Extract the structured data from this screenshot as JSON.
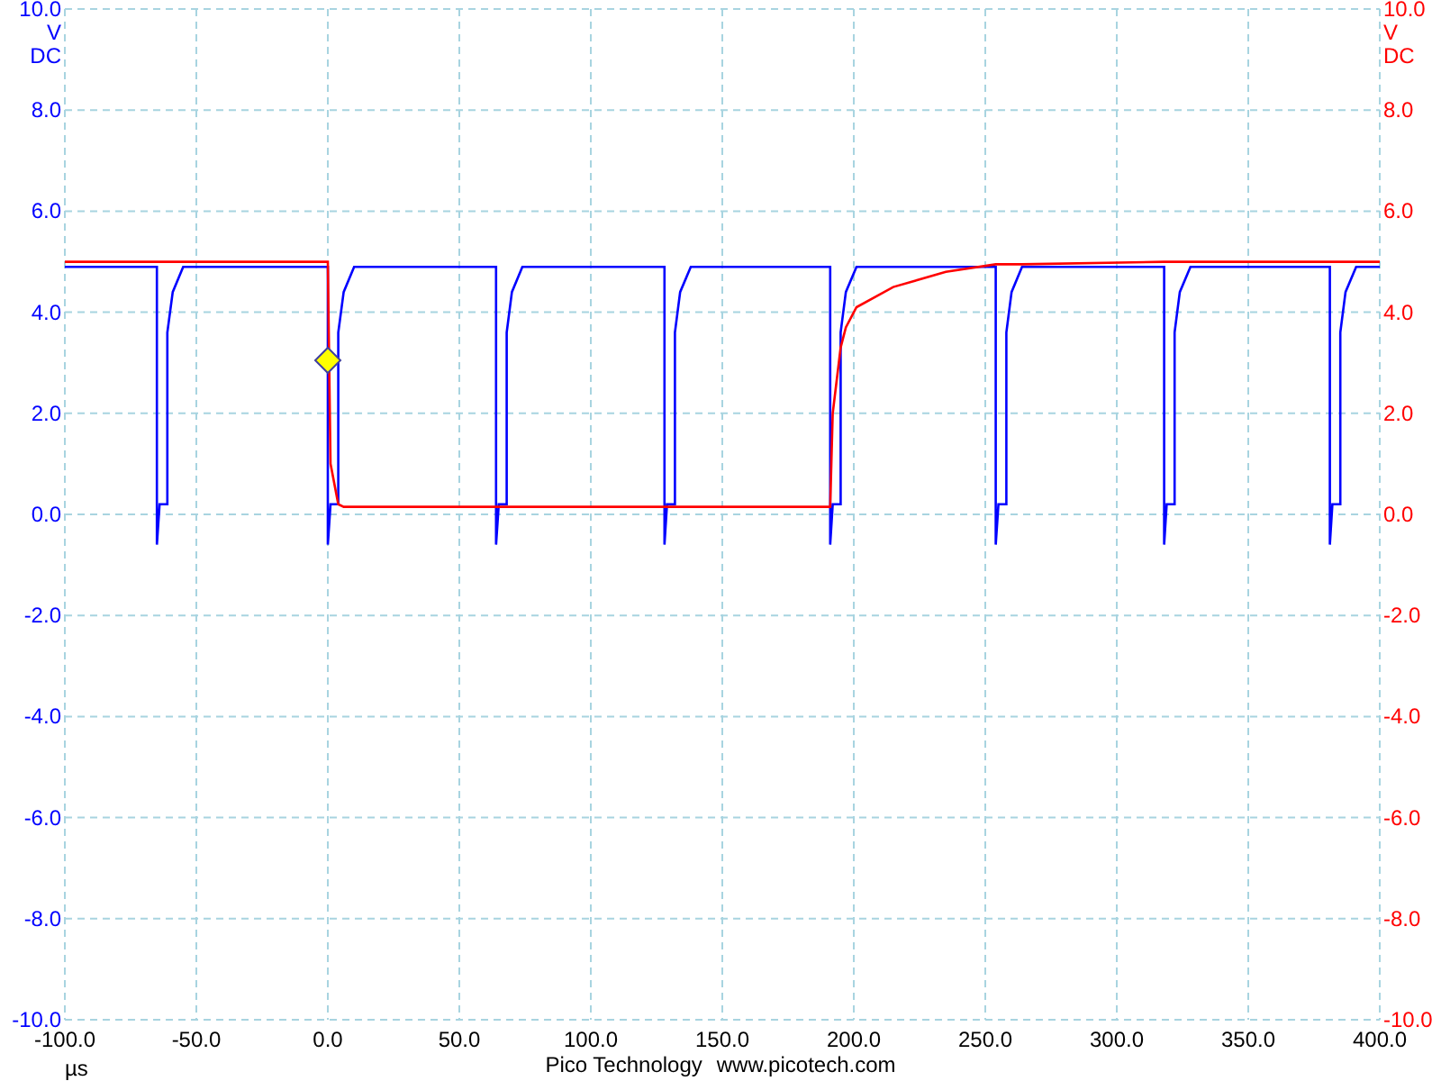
{
  "scope": {
    "chart_data": {
      "type": "line",
      "xlabel": "µs",
      "x": [
        -100,
        -65,
        -65,
        -64,
        -61,
        -61,
        -59,
        -55,
        0,
        0,
        1,
        4,
        4,
        6,
        10,
        64,
        64,
        65,
        68,
        68,
        70,
        74,
        128,
        128,
        129,
        132,
        132,
        134,
        138,
        191,
        191,
        192,
        195,
        195,
        197,
        201,
        215,
        235,
        254,
        254,
        255,
        258,
        258,
        260,
        264,
        318,
        318,
        319,
        322,
        322,
        324,
        328,
        381,
        381,
        382,
        385,
        385,
        387,
        391,
        400
      ],
      "series": [
        {
          "color": "#0000ff",
          "values": [
            4.9,
            4.9,
            -0.6,
            0.2,
            0.2,
            3.6,
            4.4,
            4.9,
            4.9,
            -0.6,
            0.2,
            0.2,
            3.6,
            4.4,
            4.9,
            4.9,
            -0.6,
            0.2,
            0.2,
            3.6,
            4.4,
            4.9,
            4.9,
            -0.6,
            0.2,
            0.2,
            3.6,
            4.4,
            4.9,
            4.9,
            -0.6,
            0.2,
            0.2,
            3.6,
            4.4,
            4.9,
            4.9,
            4.9,
            4.9,
            -0.6,
            0.2,
            0.2,
            3.6,
            4.4,
            4.9,
            4.9,
            -0.6,
            0.2,
            0.2,
            3.6,
            4.4,
            4.9,
            4.9,
            -0.6,
            0.2,
            0.2,
            3.6,
            4.4,
            4.9,
            4.9
          ]
        },
        {
          "color": "#ff0000",
          "values": [
            5.0,
            5.0,
            5.0,
            5.0,
            5.0,
            5.0,
            5.0,
            5.0,
            5.0,
            5.0,
            1.0,
            0.2,
            0.2,
            0.15,
            0.15,
            0.15,
            0.15,
            0.15,
            0.15,
            0.15,
            0.15,
            0.15,
            0.15,
            0.15,
            0.15,
            0.15,
            0.15,
            0.15,
            0.15,
            0.15,
            0.15,
            2.0,
            3.3,
            3.3,
            3.7,
            4.1,
            4.5,
            4.8,
            4.95,
            4.95,
            4.95,
            4.95,
            4.95,
            4.95,
            4.95,
            5.0,
            5.0,
            5.0,
            5.0,
            5.0,
            5.0,
            5.0,
            5.0,
            5.0,
            5.0,
            5.0,
            5.0,
            5.0,
            5.0,
            5.0
          ]
        }
      ],
      "xlim": [
        -100,
        400
      ],
      "ylim": [
        -10,
        10
      ],
      "xticks": [
        {
          "value": -100,
          "label": "-100.0"
        },
        {
          "value": -50,
          "label": "-50.0"
        },
        {
          "value": 0,
          "label": "0.0"
        },
        {
          "value": 50,
          "label": "50.0"
        },
        {
          "value": 100,
          "label": "100.0"
        },
        {
          "value": 150,
          "label": "150.0"
        },
        {
          "value": 200,
          "label": "200.0"
        },
        {
          "value": 250,
          "label": "250.0"
        },
        {
          "value": 300,
          "label": "300.0"
        },
        {
          "value": 350,
          "label": "350.0"
        },
        {
          "value": 400,
          "label": "400.0"
        }
      ],
      "yticks": [
        {
          "value": 10,
          "label": "10.0"
        },
        {
          "value": 8,
          "label": "8.0"
        },
        {
          "value": 6,
          "label": "6.0"
        },
        {
          "value": 4,
          "label": "4.0"
        },
        {
          "value": 2,
          "label": "2.0"
        },
        {
          "value": 0,
          "label": "0.0"
        },
        {
          "value": -2,
          "label": "-2.0"
        },
        {
          "value": -4,
          "label": "-4.0"
        },
        {
          "value": -6,
          "label": "-6.0"
        },
        {
          "value": -8,
          "label": "-8.0"
        },
        {
          "value": -10,
          "label": "-10.0"
        }
      ],
      "grid": true
    },
    "right_axis_ticks": [
      "10.0",
      "8.0",
      "6.0",
      "4.0",
      "2.0",
      "0.0",
      "-2.0",
      "-4.0",
      "-6.0",
      "-8.0",
      "-10.0"
    ],
    "left_unit": [
      "V",
      "DC"
    ],
    "right_unit": [
      "V",
      "DC"
    ]
  },
  "footer": {
    "company": "Pico Technology",
    "website": "www.picotech.com"
  }
}
